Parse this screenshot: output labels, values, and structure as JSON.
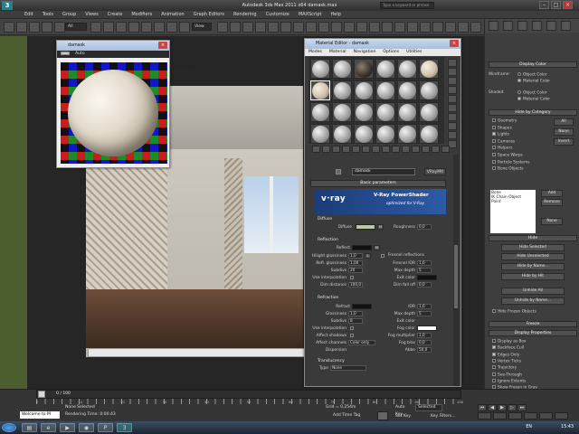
{
  "app": {
    "title": "Autodesk 3ds Max 2011 x64     damask.max",
    "search_placeholder": "Type a keyword or phrase"
  },
  "menu": [
    "Edit",
    "Tools",
    "Group",
    "Views",
    "Create",
    "Modifiers",
    "Animation",
    "Graph Editors",
    "Rendering",
    "Customize",
    "MAXScript",
    "Help"
  ],
  "toolbar": {
    "selection_filter": "All",
    "view_dropdown": "View"
  },
  "swatch_window": {
    "title": "damask",
    "menu": [
      "Auto"
    ],
    "viewport_label": "[1:1 + 800]"
  },
  "material_editor": {
    "title": "Material Editor - damask",
    "menu": [
      "Modes",
      "Material",
      "Navigation",
      "Options",
      "Utilities"
    ],
    "material_name": "damask",
    "material_type": "VRayMtl",
    "rollout_basic": "Basic parameters",
    "banner": {
      "logo": "v·ray",
      "product": "V-Ray PowerShader",
      "tagline": "optimized for V-Ray"
    },
    "diffuse": {
      "section": "Diffuse",
      "label": "Diffuse",
      "map_btn": "M",
      "roughness_label": "Roughness",
      "roughness_value": "0,0",
      "color": "#b9c9a0"
    },
    "reflection": {
      "section": "Reflection",
      "reflect_label": "Reflect",
      "hilight_label": "Hilight glossiness",
      "hilight_value": "1,0",
      "refl_gloss_label": "Refl. glossiness",
      "refl_gloss_value": "1,00",
      "subdivs_label": "Subdivs",
      "subdivs_value": "20",
      "use_interp_label": "Use interpolation",
      "dim_distance_label": "Dim distance",
      "dim_distance_value": "100,0",
      "fresnel_label": "Fresnel reflections",
      "fresnel_ior_label": "Fresnel IOR",
      "fresnel_ior_value": "1,6",
      "max_depth_label": "Max depth",
      "max_depth_value": "5",
      "exit_color_label": "Exit color",
      "dim_falloff_label": "Dim fall off",
      "dim_falloff_value": "0,0",
      "lock_btn": "L",
      "color": "#111111",
      "exit_color": "#111111"
    },
    "refraction": {
      "section": "Refraction",
      "refract_label": "Refract",
      "ior_label": "IOR",
      "ior_value": "1,6",
      "glossiness_label": "Glossiness",
      "glossiness_value": "1,0",
      "max_depth_label": "Max depth",
      "max_depth_value": "5",
      "subdivs_label": "Subdivs",
      "subdivs_value": "8",
      "exit_color_label": "Exit color",
      "use_interp_label": "Use interpolation",
      "fog_color_label": "Fog color",
      "affect_shadows_label": "Affect shadows",
      "fog_mult_label": "Fog multiplier",
      "fog_mult_value": "1,0",
      "affect_channels_label": "Affect channels",
      "affect_channels_value": "Color only",
      "fog_bias_label": "Fog bias",
      "fog_bias_value": "0,0",
      "dispersion_label": "Dispersion",
      "abbe_label": "Abbe",
      "abbe_value": "50,0",
      "color": "#111111",
      "fog_color": "#ffffff"
    },
    "translucency": {
      "section": "Translucency",
      "type_label": "Type",
      "type_value": "None"
    }
  },
  "right_panel": {
    "display_color": {
      "title": "Display Color",
      "wireframe_label": "Wireframe:",
      "shaded_label": "Shaded:",
      "wf_object_color": "Object Color",
      "wf_material_color": "Material Color",
      "sh_object_color": "Object Color",
      "sh_material_color": "Material Color"
    },
    "hide_by_category": {
      "title": "Hide by Category",
      "items": [
        "Geometry",
        "Shapes",
        "Lights",
        "Cameras",
        "Helpers",
        "Space Warps",
        "Particle Systems",
        "Bone Objects"
      ],
      "all_btn": "All",
      "none_btn": "None",
      "invert_btn": "Invert"
    },
    "list": {
      "items": [
        "Bone",
        "IK Chain Object",
        "Point"
      ],
      "add_btn": "Add",
      "remove_btn": "Remove",
      "none_btn": "None"
    },
    "hide": {
      "title": "Hide",
      "buttons": [
        "Hide Selected",
        "Hide Unselected",
        "Hide by Name...",
        "Hide by Hit",
        "Unhide All",
        "Unhide by Name...",
        "Hide Frozen Objects"
      ]
    },
    "freeze": {
      "title": "Freeze"
    },
    "display_properties": {
      "title": "Display Properties",
      "items": [
        "Display as Box",
        "Backface Cull",
        "Edges Only",
        "Vertex Ticks",
        "Trajectory",
        "See-Through",
        "Ignore Extents",
        "Show Frozen in Gray",
        "Never Degrade",
        "Vertex Colors"
      ]
    }
  },
  "bottom": {
    "time_frame": "0 / 100",
    "status": "None Selected",
    "render_time": "Rendering Time: 0:00:43",
    "maxscript": "Welcome to M",
    "auto_key": "Auto Key",
    "selected": "Selected",
    "set_key": "Set Key",
    "key_filters": "Key Filters...",
    "add_time_tag": "Add Time Tag",
    "grid": "Grid = 0,254m",
    "ticks": [
      "0",
      "10",
      "20",
      "30",
      "40",
      "50",
      "60",
      "70",
      "80",
      "90",
      "100"
    ]
  },
  "taskbar": {
    "lang": "EN",
    "clock": "15:43"
  }
}
